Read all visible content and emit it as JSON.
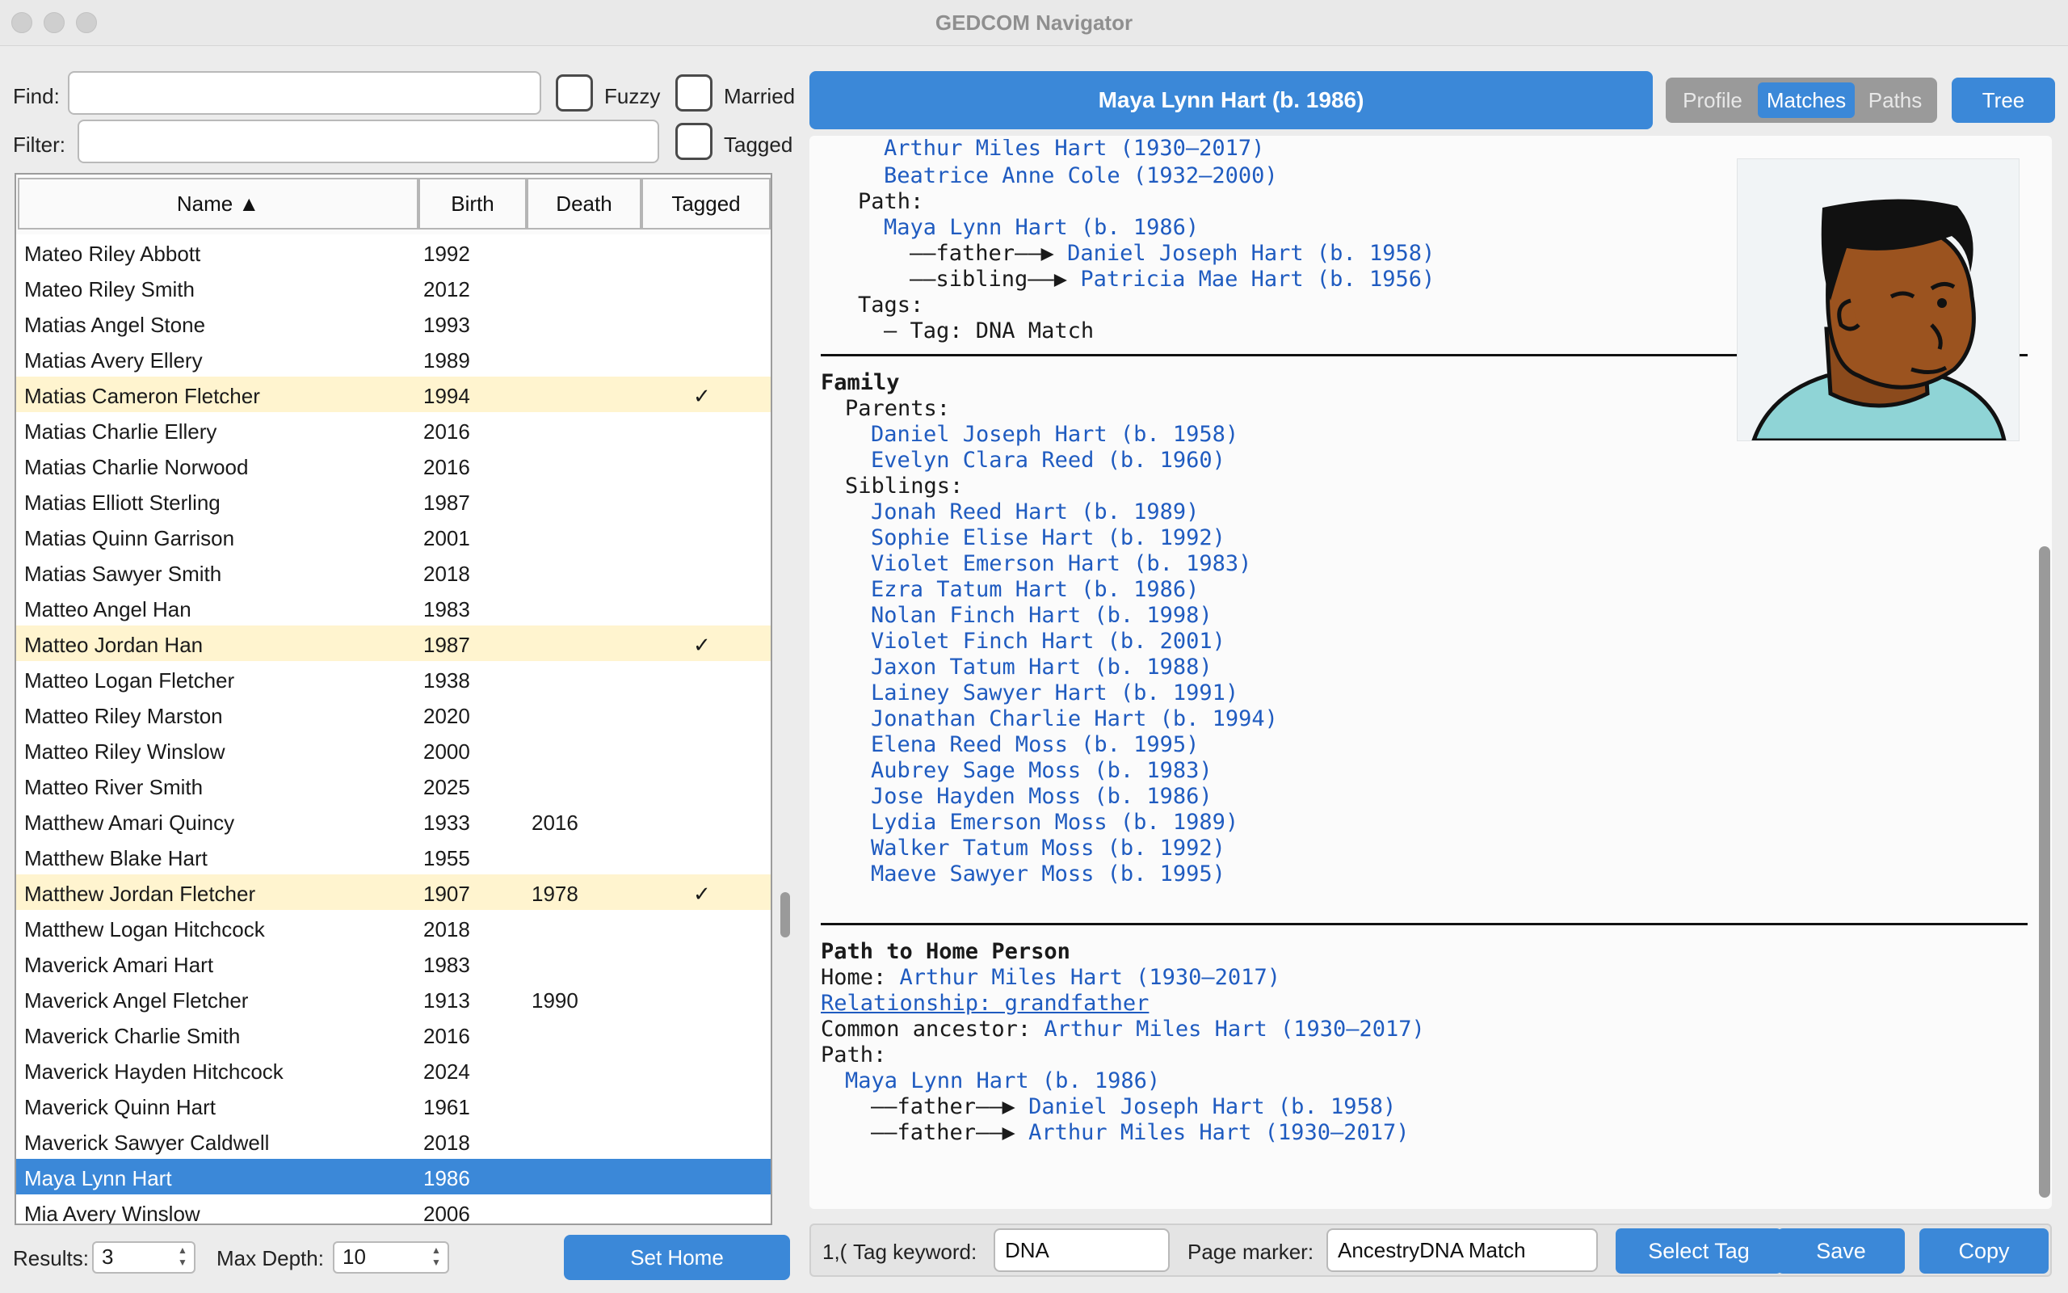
{
  "window": {
    "title": "GEDCOM Navigator"
  },
  "search": {
    "find_label": "Find:",
    "find_value": "",
    "filter_label": "Filter:",
    "filter_value": "",
    "fuzzy_label": "Fuzzy",
    "married_label": "Married",
    "tagged_label": "Tagged",
    "fuzzy_checked": false,
    "married_checked": false,
    "tagged_checked": false
  },
  "table": {
    "columns": [
      "Name ▲",
      "Birth",
      "Death",
      "Tagged"
    ],
    "rows": [
      {
        "name": "Mateo Riley Abbott",
        "birth": "1992",
        "death": "",
        "tagged": ""
      },
      {
        "name": "Mateo Riley Smith",
        "birth": "2012",
        "death": "",
        "tagged": ""
      },
      {
        "name": "Matias Angel Stone",
        "birth": "1993",
        "death": "",
        "tagged": ""
      },
      {
        "name": "Matias Avery Ellery",
        "birth": "1989",
        "death": "",
        "tagged": ""
      },
      {
        "name": "Matias Cameron Fletcher",
        "birth": "1994",
        "death": "",
        "tagged": "✓"
      },
      {
        "name": "Matias Charlie Ellery",
        "birth": "2016",
        "death": "",
        "tagged": ""
      },
      {
        "name": "Matias Charlie Norwood",
        "birth": "2016",
        "death": "",
        "tagged": ""
      },
      {
        "name": "Matias Elliott Sterling",
        "birth": "1987",
        "death": "",
        "tagged": ""
      },
      {
        "name": "Matias Quinn Garrison",
        "birth": "2001",
        "death": "",
        "tagged": ""
      },
      {
        "name": "Matias Sawyer Smith",
        "birth": "2018",
        "death": "",
        "tagged": ""
      },
      {
        "name": "Matteo Angel Han",
        "birth": "1983",
        "death": "",
        "tagged": ""
      },
      {
        "name": "Matteo Jordan Han",
        "birth": "1987",
        "death": "",
        "tagged": "✓"
      },
      {
        "name": "Matteo Logan Fletcher",
        "birth": "1938",
        "death": "",
        "tagged": ""
      },
      {
        "name": "Matteo Riley Marston",
        "birth": "2020",
        "death": "",
        "tagged": ""
      },
      {
        "name": "Matteo Riley Winslow",
        "birth": "2000",
        "death": "",
        "tagged": ""
      },
      {
        "name": "Matteo River Smith",
        "birth": "2025",
        "death": "",
        "tagged": ""
      },
      {
        "name": "Matthew Amari Quincy",
        "birth": "1933",
        "death": "2016",
        "tagged": ""
      },
      {
        "name": "Matthew Blake Hart",
        "birth": "1955",
        "death": "",
        "tagged": ""
      },
      {
        "name": "Matthew Jordan Fletcher",
        "birth": "1907",
        "death": "1978",
        "tagged": "✓"
      },
      {
        "name": "Matthew Logan Hitchcock",
        "birth": "2018",
        "death": "",
        "tagged": ""
      },
      {
        "name": "Maverick Amari Hart",
        "birth": "1983",
        "death": "",
        "tagged": ""
      },
      {
        "name": "Maverick Angel Fletcher",
        "birth": "1913",
        "death": "1990",
        "tagged": ""
      },
      {
        "name": "Maverick Charlie Smith",
        "birth": "2016",
        "death": "",
        "tagged": ""
      },
      {
        "name": "Maverick Hayden Hitchcock",
        "birth": "2024",
        "death": "",
        "tagged": ""
      },
      {
        "name": "Maverick Quinn Hart",
        "birth": "1961",
        "death": "",
        "tagged": ""
      },
      {
        "name": "Maverick Sawyer Caldwell",
        "birth": "2018",
        "death": "",
        "tagged": ""
      },
      {
        "name": "Maya Lynn Hart",
        "birth": "1986",
        "death": "",
        "tagged": "",
        "selected": true
      },
      {
        "name": "Mia Avery Winslow",
        "birth": "2006",
        "death": "",
        "tagged": ""
      }
    ]
  },
  "controls": {
    "results_label": "Results:",
    "results_value": "3",
    "max_depth_label": "Max Depth:",
    "max_depth_value": "10",
    "set_home_label": "Set Home"
  },
  "person_header": "Maya Lynn Hart (b. 1986)",
  "view_tabs": [
    "Profile",
    "Matches",
    "Paths"
  ],
  "active_tab": "Matches",
  "tree_button": "Tree",
  "avatar": {
    "icon": "person-avatar-icon"
  },
  "document": {
    "top_section": {
      "lines": [
        {
          "indent": 4,
          "text": "Arthur Miles Hart (1930–2017)",
          "kind": "link"
        },
        {
          "indent": 4,
          "text": "Beatrice Anne Cole (1932–2000)",
          "kind": "link"
        },
        {
          "indent": 2,
          "text": "Path:",
          "kind": "text"
        },
        {
          "indent": 4,
          "text": "Maya Lynn Hart (b. 1986)",
          "kind": "link"
        },
        {
          "indent": 6,
          "prefix": "——father——▶ ",
          "text": "Daniel Joseph Hart (b. 1958)",
          "kind": "link"
        },
        {
          "indent": 6,
          "prefix": "——sibling——▶ ",
          "text": "Patricia Mae Hart (b. 1956)",
          "kind": "link"
        },
        {
          "indent": 2,
          "text": "Tags:",
          "kind": "text"
        },
        {
          "indent": 4,
          "text": "– Tag: DNA Match",
          "kind": "text"
        }
      ]
    },
    "family": {
      "heading": "Family",
      "parents_label": "Parents:",
      "parents": [
        "Daniel Joseph Hart (b. 1958)",
        "Evelyn Clara Reed (b. 1960)"
      ],
      "siblings_label": "Siblings:",
      "siblings": [
        "Jonah Reed Hart (b. 1989)",
        "Sophie Elise Hart (b. 1992)",
        "Violet Emerson Hart (b. 1983)",
        "Ezra Tatum Hart (b. 1986)",
        "Nolan Finch Hart (b. 1998)",
        "Violet Finch Hart (b. 2001)",
        "Jaxon Tatum Hart (b. 1988)",
        "Lainey Sawyer Hart (b. 1991)",
        "Jonathan Charlie Hart (b. 1994)",
        "Elena Reed Moss (b. 1995)",
        "Aubrey Sage Moss (b. 1983)",
        "Jose Hayden Moss (b. 1986)",
        "Lydia Emerson Moss (b. 1989)",
        "Walker Tatum Moss (b. 1992)",
        "Maeve Sawyer Moss (b. 1995)"
      ]
    },
    "path_home": {
      "heading": "Path to Home Person",
      "home_label": "Home:",
      "home_value": "Arthur Miles Hart (1930–2017)",
      "relationship": "Relationship: grandfather",
      "common_label": "Common ancestor:",
      "common_value": "Arthur Miles Hart (1930–2017)",
      "path_label": "Path:",
      "path_start": "Maya Lynn Hart (b. 1986)",
      "steps": [
        {
          "prefix": "——father——▶ ",
          "text": "Daniel Joseph Hart (b. 1958)"
        },
        {
          "prefix": "——father——▶ ",
          "text": "Arthur Miles Hart (1930–2017)"
        }
      ]
    }
  },
  "bottom": {
    "truncated_label": "1,(",
    "tag_keyword_label": "Tag keyword:",
    "tag_keyword_value": "DNA",
    "page_marker_label": "Page marker:",
    "page_marker_value": "AncestryDNA Match",
    "select_tag_label": "Select Tag",
    "save_label": "Save",
    "copy_label": "Copy"
  },
  "colors": {
    "accent": "#3b88d8",
    "tagged_row": "#fff4cf",
    "link": "#1f5bc0"
  }
}
